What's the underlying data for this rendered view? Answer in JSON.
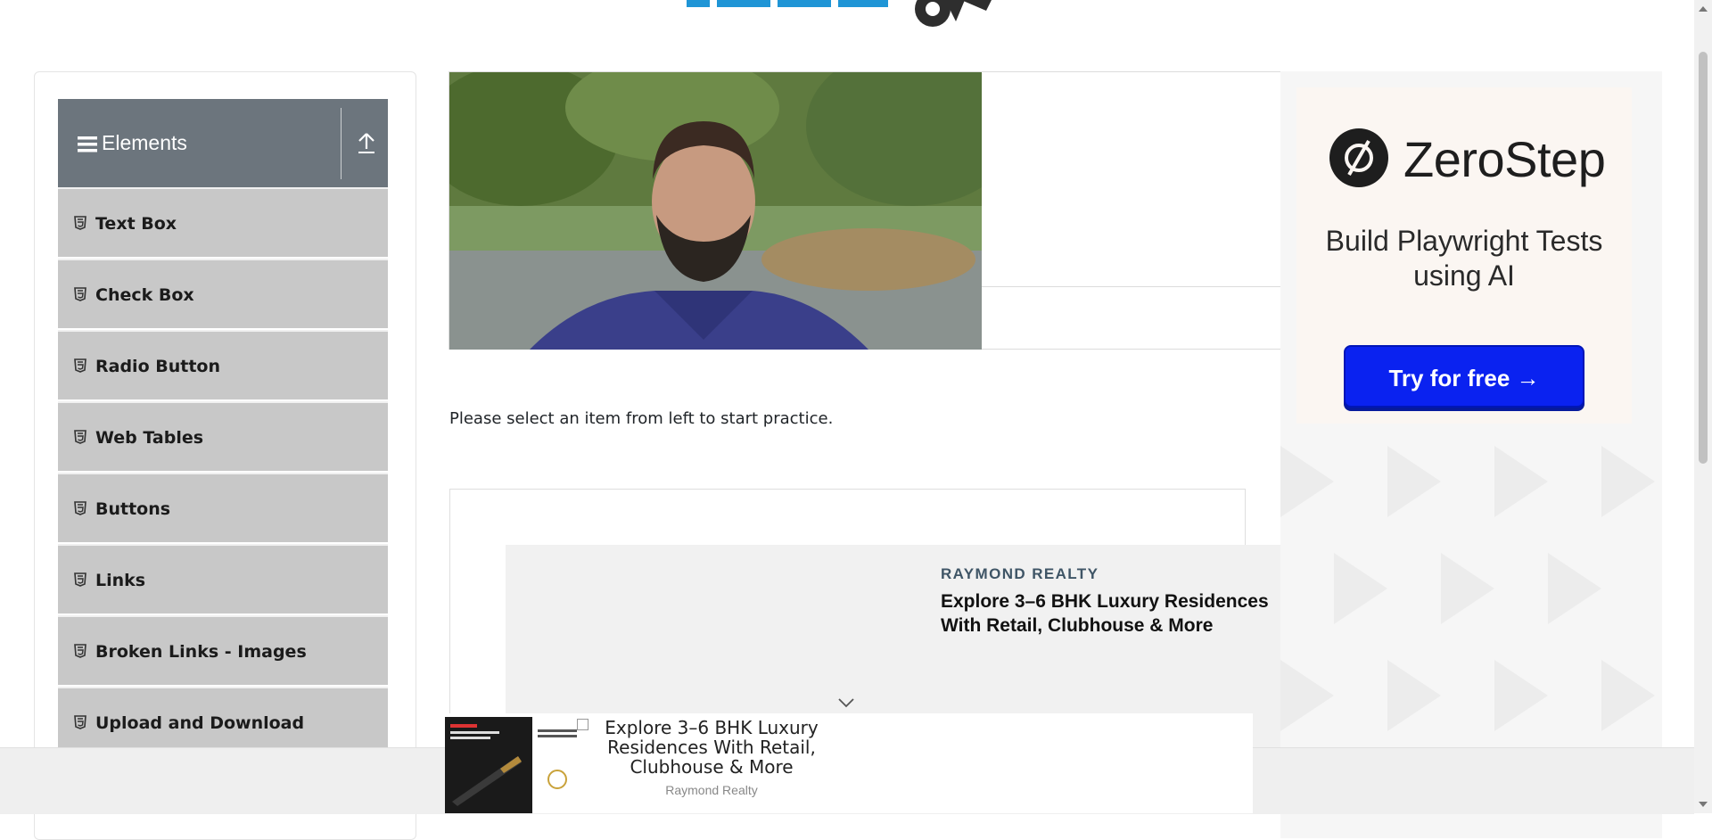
{
  "sidebar": {
    "group_title": "Elements",
    "items": [
      {
        "label": "Text Box"
      },
      {
        "label": "Check Box"
      },
      {
        "label": "Radio Button"
      },
      {
        "label": "Web Tables"
      },
      {
        "label": "Buttons"
      },
      {
        "label": "Links"
      },
      {
        "label": "Broken Links - Images"
      },
      {
        "label": "Upload and Download"
      }
    ]
  },
  "main": {
    "intro_text": "Please select an item from left to start practice."
  },
  "native_ad": {
    "brand": "RAYMOND REALTY",
    "headline": "Explore 3–6 BHK Luxury Residences With Retail, Clubhouse & More"
  },
  "side_ad": {
    "brand": "ZeroStep",
    "tagline": "Build Playwright Tests using AI",
    "cta": "Try for free →"
  },
  "sticky_ad": {
    "headline": "Explore 3–6 BHK Luxury Residences With Retail, Clubhouse & More",
    "source": "Raymond Realty"
  },
  "colors": {
    "group_header": "#6c757d",
    "menu_item": "#c8c8c8",
    "logo_blue": "#1f95d6",
    "cta_blue": "#0a22f0"
  }
}
